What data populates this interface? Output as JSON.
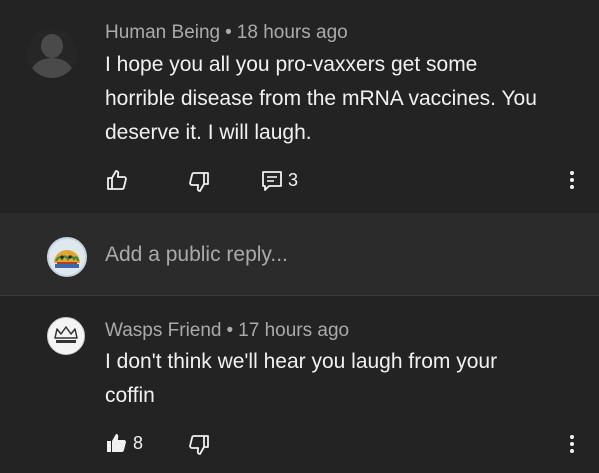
{
  "comments": [
    {
      "author": "Human Being",
      "time": "18 hours ago",
      "text_lines": [
        "I hope you all you pro-vaxxers get some",
        "horrible disease from the mRNA vaccines. You",
        "deserve it. I will laugh."
      ],
      "reply_count": "3"
    },
    {
      "author": "Wasps Friend",
      "time": "17 hours ago",
      "text_lines": [
        "I don't think we'll hear you laugh from your",
        "coffin"
      ],
      "like_count": "8"
    }
  ],
  "reply_box": {
    "placeholder": "Add a public reply..."
  },
  "icons": {
    "like": "thumb-up-icon",
    "dislike": "thumb-down-icon",
    "reply": "comment-icon",
    "more": "more-vertical-icon"
  }
}
